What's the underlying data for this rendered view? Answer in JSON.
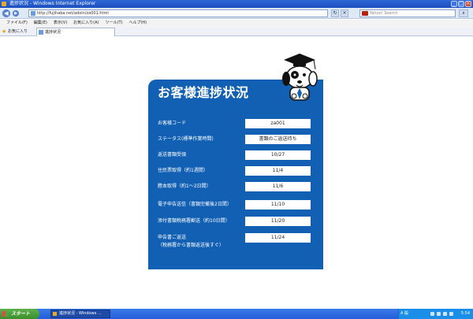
{
  "window": {
    "title": "進捗状況 - Windows Internet Explorer"
  },
  "address": {
    "url": "http://fujihaba.net/adoin/za001.html",
    "search_placeholder": "Yahoo! Search"
  },
  "menu": [
    "ファイル(F)",
    "編集(E)",
    "表示(V)",
    "お気に入り(A)",
    "ツール(T)",
    "ヘルプ(H)"
  ],
  "favorites_label": "お気に入り",
  "tab_title": "進捗状況",
  "card": {
    "title": "お客様進捗状況",
    "rows": [
      {
        "label": "お客様コード",
        "value": "za001"
      },
      {
        "label": "ステータス(標準作業時間)",
        "value": "書類のご返送待ち"
      },
      {
        "label": "返送書類受領",
        "value": "10/27"
      },
      {
        "label": "住民票取得（約1週間）",
        "value": "11/4"
      },
      {
        "label": "謄本取得（約1〜2日間）",
        "value": "11/6"
      },
      {
        "label": "電子申告送信（書類完備後2日間）",
        "value": "11/10"
      },
      {
        "label": "添付書類税務署郵送（約10日間）",
        "value": "11/20"
      },
      {
        "label": "申告書ご返送",
        "label2": "（税務署から書類返送後すぐ）",
        "value": "11/24"
      }
    ]
  },
  "taskbar": {
    "start": "スタート",
    "task": "進捗状況 - Windows ...",
    "ime": "A 般",
    "clock": "5:54"
  }
}
